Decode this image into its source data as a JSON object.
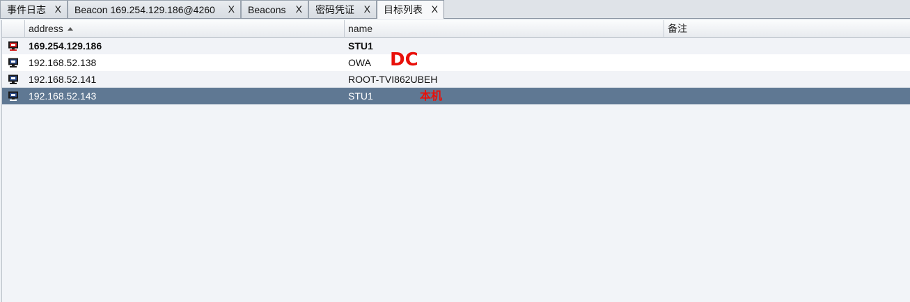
{
  "tabs": [
    {
      "label": "事件日志",
      "close": "X",
      "active": false
    },
    {
      "label": "Beacon 169.254.129.186@4260",
      "close": "X",
      "active": false
    },
    {
      "label": "Beacons",
      "close": "X",
      "active": false
    },
    {
      "label": "密码凭证",
      "close": "X",
      "active": false
    },
    {
      "label": "目标列表",
      "close": "X",
      "active": true
    }
  ],
  "table": {
    "columns": [
      {
        "label": "",
        "key": "icon"
      },
      {
        "label": "address",
        "key": "address",
        "sorted": "ascending"
      },
      {
        "label": "name",
        "key": "name"
      },
      {
        "label": "备注",
        "key": "note"
      }
    ],
    "rows": [
      {
        "icon": "monitor-compromised-icon",
        "address": "169.254.129.186",
        "name": "STU1",
        "note": "",
        "bold": true
      },
      {
        "icon": "monitor-icon",
        "address": "192.168.52.138",
        "name": "OWA",
        "note": ""
      },
      {
        "icon": "monitor-icon",
        "address": "192.168.52.141",
        "name": "ROOT-TVI862UBEH",
        "note": ""
      },
      {
        "icon": "monitor-icon",
        "address": "192.168.52.143",
        "name": "STU1",
        "note": "",
        "selected": true
      }
    ]
  },
  "annotations": {
    "dc": "DC",
    "local": "本机"
  },
  "colors": {
    "selected_row": "#5f7893",
    "annotation": "#e8100a",
    "icon_red": "#d42020"
  }
}
